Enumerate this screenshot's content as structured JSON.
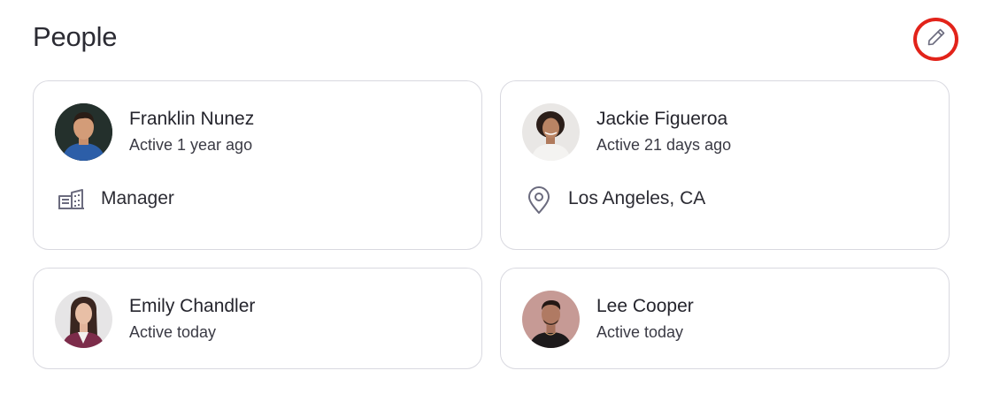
{
  "header": {
    "title": "People",
    "edit_icon": "pencil-icon"
  },
  "colors": {
    "highlight_ring": "#e2231a",
    "card_border": "#d9d9e0",
    "icon_gray": "#6b6b7e"
  },
  "people": [
    {
      "name": "Franklin Nunez",
      "status": "Active 1 year ago",
      "detail_icon": "building-icon",
      "detail": "Manager"
    },
    {
      "name": "Jackie Figueroa",
      "status": "Active 21 days ago",
      "detail_icon": "location-pin-icon",
      "detail": "Los Angeles, CA"
    },
    {
      "name": "Emily Chandler",
      "status": "Active today"
    },
    {
      "name": "Lee Cooper",
      "status": "Active today"
    }
  ]
}
